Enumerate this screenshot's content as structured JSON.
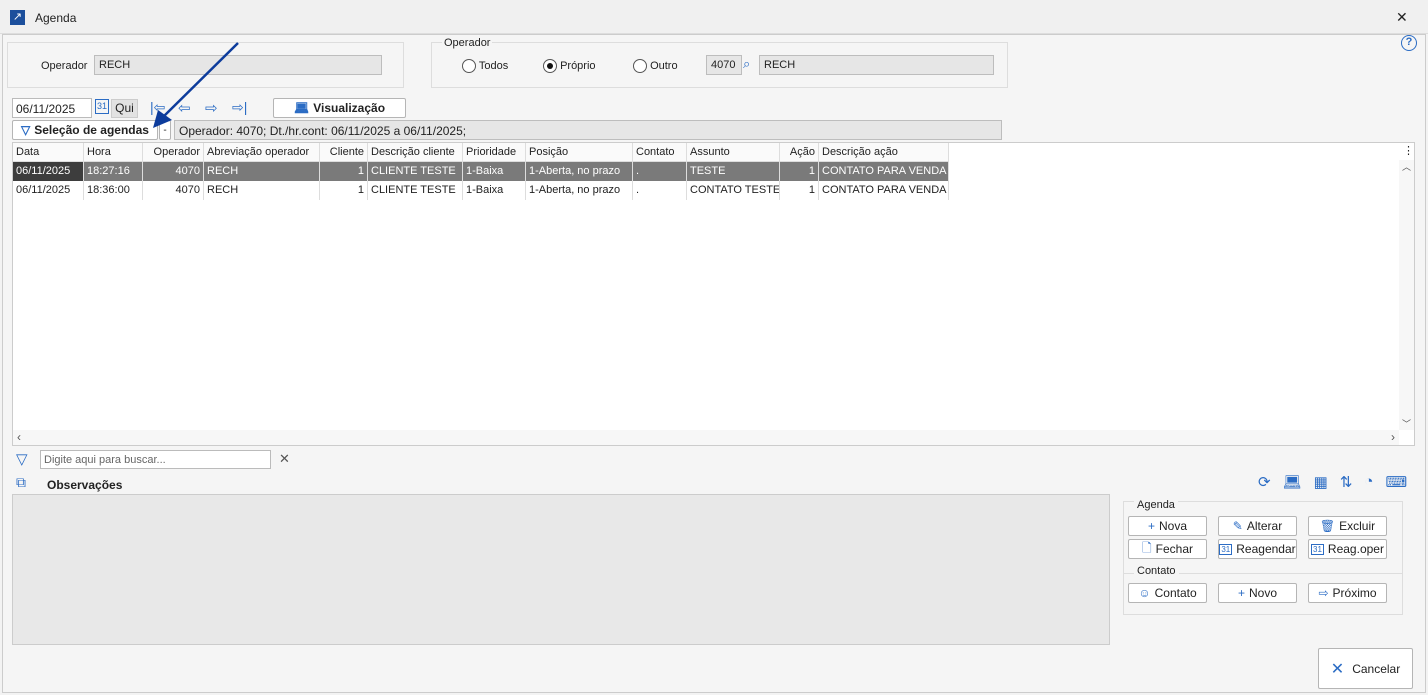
{
  "window": {
    "title": "Agenda",
    "close": "✕",
    "help": "?"
  },
  "operator_box": {
    "label": "Operador",
    "value": "RECH"
  },
  "operator_filter": {
    "legend": "Operador",
    "options": [
      "Todos",
      "Próprio",
      "Outro"
    ],
    "selected": "Próprio",
    "code": "4070",
    "name": "RECH"
  },
  "toolbar": {
    "date": "06/11/2025",
    "weekday": "Qui",
    "view_label": "Visualização",
    "selection_label": "Seleção de agendas",
    "dropdown": "-",
    "filter_summary": "Operador: 4070; Dt./hr.cont: 06/11/2025 a 06/11/2025;"
  },
  "grid": {
    "columns": [
      "Data",
      "Hora",
      "Operador",
      "Abreviação operador",
      "Cliente",
      "Descrição cliente",
      "Prioridade",
      "Posição",
      "Contato",
      "Assunto",
      "Ação",
      "Descrição ação"
    ],
    "rows": [
      [
        "06/11/2025",
        "18:27:16",
        "4070",
        "RECH",
        "1",
        "CLIENTE TESTE",
        "1-Baixa",
        "1-Aberta, no prazo",
        ".",
        "TESTE",
        "1",
        "CONTATO PARA VENDA"
      ],
      [
        "06/11/2025",
        "18:36:00",
        "4070",
        "RECH",
        "1",
        "CLIENTE TESTE",
        "1-Baixa",
        "1-Aberta, no prazo",
        ".",
        "CONTATO TESTE",
        "1",
        "CONTATO PARA VENDA"
      ]
    ]
  },
  "search": {
    "placeholder": "Digite aqui para buscar..."
  },
  "observations": {
    "label": "Observações"
  },
  "agenda_panel": {
    "legend": "Agenda",
    "buttons": [
      "Nova",
      "Alterar",
      "Excluir",
      "Fechar",
      "Reagendar",
      "Reag.oper"
    ]
  },
  "contact_panel": {
    "legend": "Contato",
    "buttons": [
      "Contato",
      "Novo",
      "Próximo"
    ]
  },
  "footer": {
    "cancel": "Cancelar"
  },
  "colors": {
    "accent": "#2b6cc4",
    "selected_row": "#7a7a7a",
    "arrow": "#0d3c9c"
  }
}
